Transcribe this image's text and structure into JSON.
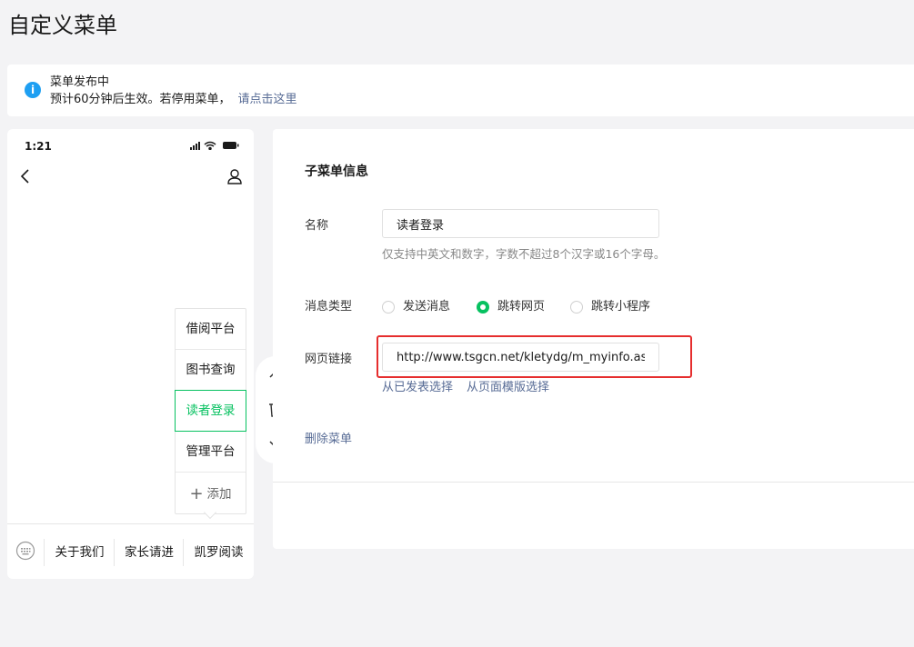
{
  "page": {
    "title": "自定义菜单"
  },
  "notice": {
    "title": "菜单发布中",
    "text": "预计60分钟后生效。若停用菜单，",
    "link": "请点击这里",
    "icon_glyph": "i",
    "icon": "info-icon"
  },
  "phone": {
    "time": "1:21",
    "status_icons": [
      "signal-icon",
      "wifi-icon",
      "battery-icon"
    ],
    "submenu": [
      {
        "label": "借阅平台",
        "active": false
      },
      {
        "label": "图书查询",
        "active": false
      },
      {
        "label": "读者登录",
        "active": true
      },
      {
        "label": "管理平台",
        "active": false
      }
    ],
    "add_label": "添加",
    "add_glyph": "+",
    "menubar": [
      {
        "label": "关于我们"
      },
      {
        "label": "家长请进"
      },
      {
        "label": "凯罗阅读"
      }
    ]
  },
  "actions": [
    "arrow-up-icon",
    "trash-icon",
    "arrow-down-icon"
  ],
  "form": {
    "title": "子菜单信息",
    "name_label": "名称",
    "name_value": "读者登录",
    "name_hint": "仅支持中英文和数字，字数不超过8个汉字或16个字母。",
    "type_label": "消息类型",
    "options": [
      {
        "label": "发送消息",
        "checked": false
      },
      {
        "label": "跳转网页",
        "checked": true
      },
      {
        "label": "跳转小程序",
        "checked": false
      }
    ],
    "url_label": "网页链接",
    "url_value": "http://www.tsgcn.net/kletydg/m_myinfo.aspx",
    "select_published": "从已发表选择",
    "select_template": "从页面模版选择",
    "delete": "删除菜单"
  },
  "colors": {
    "accent": "#07c160",
    "link": "#576b95",
    "highlight": "#e62e2e",
    "info": "#1e9ff2"
  }
}
